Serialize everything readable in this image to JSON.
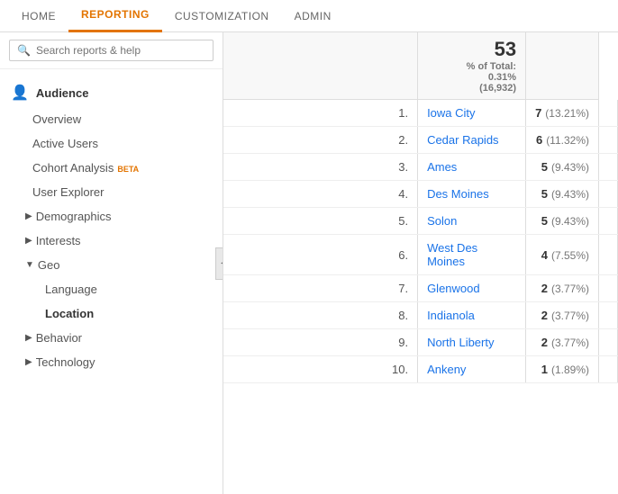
{
  "nav": {
    "items": [
      {
        "label": "HOME",
        "active": false
      },
      {
        "label": "REPORTING",
        "active": true
      },
      {
        "label": "CUSTOMIZATION",
        "active": false
      },
      {
        "label": "ADMIN",
        "active": false
      }
    ]
  },
  "sidebar": {
    "search_placeholder": "Search reports & help",
    "audience_label": "Audience",
    "items": [
      {
        "label": "Overview",
        "type": "link"
      },
      {
        "label": "Active Users",
        "type": "link"
      },
      {
        "label": "Cohort Analysis",
        "type": "link",
        "beta": true
      },
      {
        "label": "User Explorer",
        "type": "link"
      },
      {
        "label": "Demographics",
        "type": "group",
        "expanded": false
      },
      {
        "label": "Interests",
        "type": "group",
        "expanded": false
      },
      {
        "label": "Geo",
        "type": "group",
        "expanded": true
      },
      {
        "label": "Language",
        "type": "sub"
      },
      {
        "label": "Location",
        "type": "sub",
        "bold": true
      },
      {
        "label": "Behavior",
        "type": "group",
        "expanded": false
      },
      {
        "label": "Technology",
        "type": "group",
        "expanded": false
      }
    ],
    "beta_label": "BETA"
  },
  "table": {
    "header": {
      "value": "53",
      "sub": "% of Total:",
      "sub2": "0.31%",
      "sub3": "(16,932)"
    },
    "rows": [
      {
        "rank": "1.",
        "city": "Iowa City",
        "value": "7",
        "pct": "(13.21%)"
      },
      {
        "rank": "2.",
        "city": "Cedar Rapids",
        "value": "6",
        "pct": "(11.32%)"
      },
      {
        "rank": "3.",
        "city": "Ames",
        "value": "5",
        "pct": "(9.43%)"
      },
      {
        "rank": "4.",
        "city": "Des Moines",
        "value": "5",
        "pct": "(9.43%)"
      },
      {
        "rank": "5.",
        "city": "Solon",
        "value": "5",
        "pct": "(9.43%)"
      },
      {
        "rank": "6.",
        "city": "West Des Moines",
        "value": "4",
        "pct": "(7.55%)"
      },
      {
        "rank": "7.",
        "city": "Glenwood",
        "value": "2",
        "pct": "(3.77%)"
      },
      {
        "rank": "8.",
        "city": "Indianola",
        "value": "2",
        "pct": "(3.77%)"
      },
      {
        "rank": "9.",
        "city": "North Liberty",
        "value": "2",
        "pct": "(3.77%)"
      },
      {
        "rank": "10.",
        "city": "Ankeny",
        "value": "1",
        "pct": "(1.89%)"
      }
    ]
  }
}
